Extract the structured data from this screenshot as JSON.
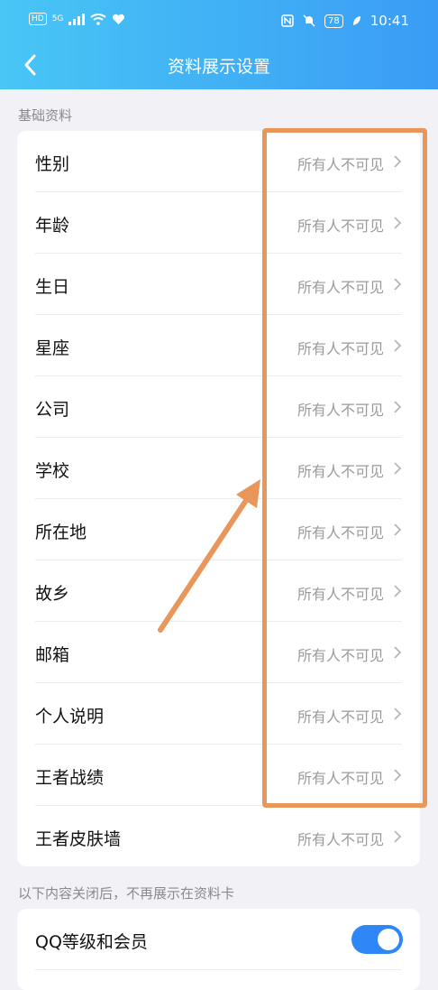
{
  "status_bar": {
    "hd": "HD",
    "network": "5G",
    "battery": "78",
    "time": "10:41"
  },
  "header": {
    "title": "资料展示设置"
  },
  "sections": [
    {
      "label": "基础资料",
      "rows": [
        {
          "label": "性别",
          "value": "所有人不可见"
        },
        {
          "label": "年龄",
          "value": "所有人不可见"
        },
        {
          "label": "生日",
          "value": "所有人不可见"
        },
        {
          "label": "星座",
          "value": "所有人不可见"
        },
        {
          "label": "公司",
          "value": "所有人不可见"
        },
        {
          "label": "学校",
          "value": "所有人不可见"
        },
        {
          "label": "所在地",
          "value": "所有人不可见"
        },
        {
          "label": "故乡",
          "value": "所有人不可见"
        },
        {
          "label": "邮箱",
          "value": "所有人不可见"
        },
        {
          "label": "个人说明",
          "value": "所有人不可见"
        },
        {
          "label": "王者战绩",
          "value": "所有人不可见"
        },
        {
          "label": "王者皮肤墙",
          "value": "所有人不可见"
        }
      ]
    },
    {
      "label": "以下内容关闭后，不再展示在资料卡",
      "rows": [
        {
          "label": "QQ等级和会员",
          "toggle_on": true
        }
      ]
    }
  ],
  "colors": {
    "header_start": "#48c6f5",
    "header_end": "#3a9cf5",
    "toggle_on": "#2f86f6",
    "annotation": "#e8965a"
  }
}
